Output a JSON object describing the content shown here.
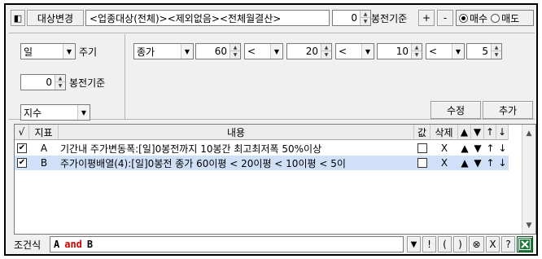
{
  "toolbar": {
    "change_target_label": "대상변경",
    "target_text": "<업종대상(전체)><제외없음><전체월결산>",
    "bar_offset_value": "0",
    "bar_basis_label": "봉전기준",
    "plus_label": "+",
    "minus_label": "-",
    "buy_label": "매수",
    "sell_label": "매도",
    "buy_selected": true
  },
  "left_panel": {
    "period_value": "일",
    "period_label": "주기",
    "bar_offset_value": "0",
    "bar_basis_label": "봉전기준",
    "indicator_value": "지수"
  },
  "conditions": {
    "price_type": "종가",
    "value1": "60",
    "op1": "<",
    "value2": "20",
    "op2": "<",
    "value3": "10",
    "op3": "<",
    "value4": "5"
  },
  "buttons": {
    "modify_label": "수정",
    "add_label": "추가"
  },
  "grid": {
    "columns": {
      "check": "√",
      "indicator": "지표",
      "content": "내용",
      "value": "값",
      "delete": "삭제"
    },
    "rows": [
      {
        "checked": true,
        "indicator": "A",
        "content": "기간내 주가변동폭:[일]0봉전까지 10봉간 최고최저폭 50%이상",
        "value_checked": false,
        "delete": "X",
        "selected": false
      },
      {
        "checked": true,
        "indicator": "B",
        "content": "주가이평배열(4):[일]0봉전 종가 60이평 < 20이평 < 10이평 < 5이",
        "value_checked": false,
        "delete": "X",
        "selected": true
      }
    ]
  },
  "formula": {
    "label": "조건식",
    "expression_a": "A",
    "expression_op": "and",
    "expression_b": "B",
    "buttons": [
      "▼",
      "!",
      "(",
      ")",
      "⊗",
      "X",
      "?"
    ]
  },
  "colors": {
    "selected_row": "#cfe0f8",
    "and_keyword": "#d40000",
    "excel_green": "#1d7a3a"
  }
}
